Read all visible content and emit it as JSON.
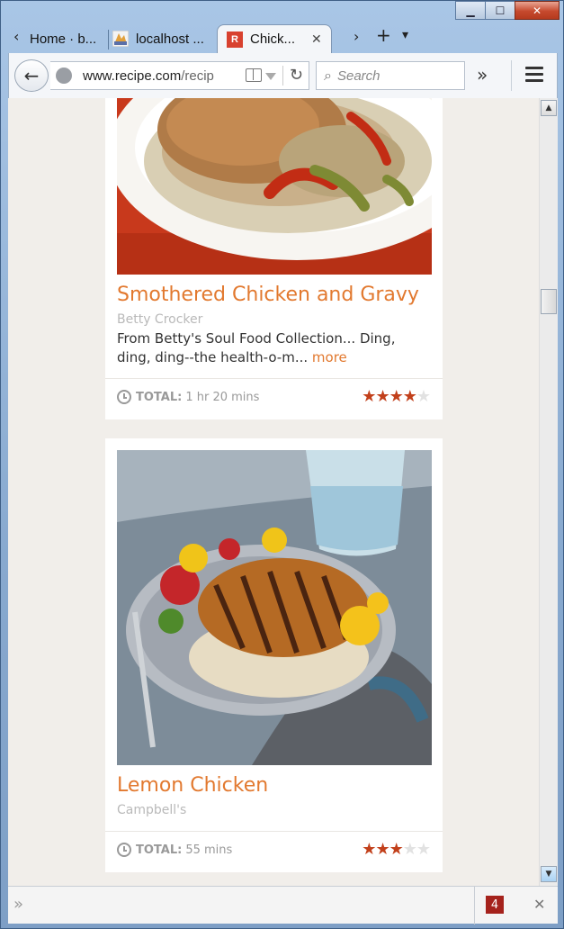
{
  "window": {
    "minimize": "▁",
    "maximize": "☐",
    "close": "✕"
  },
  "tabs": [
    {
      "label": "Home · b...",
      "icon": "globe-icon"
    },
    {
      "label": "localhost ...",
      "icon": "pma-icon"
    },
    {
      "label": "Chick...",
      "icon": "recipe-r-icon",
      "icon_text": "R",
      "active": true
    }
  ],
  "tabstrip": {
    "scroll_left": "‹",
    "scroll_right": "›",
    "new_tab": "+",
    "list_all": "▾",
    "close_tab": "✕"
  },
  "navbar": {
    "back": "←",
    "url_domain": "www.recipe.com",
    "url_path": "/recip",
    "reload": "↻",
    "search_placeholder": "Search",
    "search_glyph": "⌕",
    "overflow": "»"
  },
  "recipes": [
    {
      "title": "Smothered Chicken and Gravy",
      "source": "Betty Crocker",
      "description": "From Betty's Soul Food Collection... Ding, ding, ding--the health-o-m...",
      "more": "more",
      "total_label": "TOTAL:",
      "total_time": "1 hr 20 mins",
      "rating": 4,
      "rating_max": 5
    },
    {
      "title": "Lemon Chicken",
      "source": "Campbell's",
      "total_label": "TOTAL:",
      "total_time": "55 mins",
      "rating": 3,
      "rating_max": 5
    }
  ],
  "bottombar": {
    "arrows": "»",
    "badge": "4",
    "close": "✕"
  },
  "colors": {
    "accent": "#e2792f",
    "star_on": "#c2401b",
    "star_off": "#e2e2e2",
    "badge": "#a5221c"
  }
}
